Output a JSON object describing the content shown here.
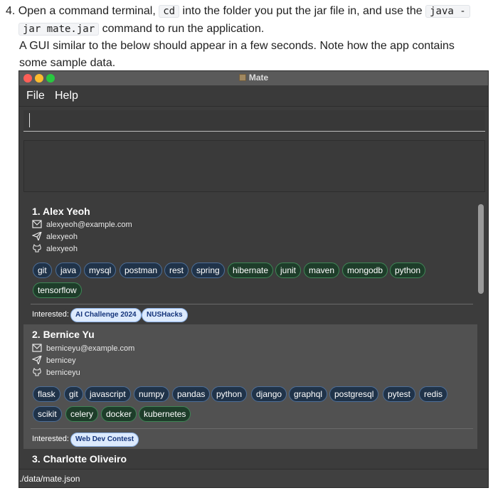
{
  "instructions": {
    "step_number": "4.",
    "line1_pre": "Open a command terminal,",
    "line1_code1": "cd",
    "line1_mid": "into the folder you put the jar file in, and use the",
    "line1_code2": "java -",
    "line2_code": "jar mate.jar",
    "line2_post": "command to run the application.",
    "line3": "A GUI similar to the below should appear in a few seconds. Note how the app contains",
    "line4": "some sample data."
  },
  "window": {
    "title": "Mate",
    "menu": [
      "File",
      "Help"
    ],
    "command_input_value": "",
    "result_display_text": "",
    "status_bar_path": "./data/mate.json"
  },
  "persons": [
    {
      "index_name": "1. Alex Yeoh",
      "email": "alexyeoh@example.com",
      "telegram": "alexyeoh",
      "github": "alexyeoh",
      "tags": [
        {
          "label": "git",
          "color": "blue"
        },
        {
          "label": "java",
          "color": "blue"
        },
        {
          "label": "mysql",
          "color": "blue"
        },
        {
          "label": "postman",
          "color": "blue"
        },
        {
          "label": "rest",
          "color": "blue"
        },
        {
          "label": "spring",
          "color": "blue"
        },
        {
          "label": "hibernate",
          "color": "green"
        },
        {
          "label": "junit",
          "color": "green"
        },
        {
          "label": "maven",
          "color": "green"
        },
        {
          "label": "mongodb",
          "color": "green"
        },
        {
          "label": "python",
          "color": "green"
        },
        {
          "label": "tensorflow",
          "color": "green"
        }
      ],
      "interested_label": "Interested:",
      "interested": [
        "AI Challenge 2024",
        "NUSHacks"
      ]
    },
    {
      "index_name": "2. Bernice Yu",
      "email": "berniceyu@example.com",
      "telegram": "bernicey",
      "github": "berniceyu",
      "tags": [
        {
          "label": "flask",
          "color": "blue"
        },
        {
          "label": "git",
          "color": "blue"
        },
        {
          "label": "javascript",
          "color": "blue"
        },
        {
          "label": "numpy",
          "color": "blue"
        },
        {
          "label": "pandas",
          "color": "blue"
        },
        {
          "label": "python",
          "color": "blue"
        },
        {
          "label": "django",
          "color": "blue"
        },
        {
          "label": "graphql",
          "color": "blue"
        },
        {
          "label": "postgresql",
          "color": "blue"
        },
        {
          "label": "pytest",
          "color": "blue"
        },
        {
          "label": "redis",
          "color": "blue"
        },
        {
          "label": "scikit",
          "color": "blue"
        },
        {
          "label": "celery",
          "color": "green"
        },
        {
          "label": "docker",
          "color": "green"
        },
        {
          "label": "kubernetes",
          "color": "green"
        }
      ],
      "interested_label": "Interested:",
      "interested": [
        "Web Dev Contest"
      ]
    },
    {
      "index_name": "3. Charlotte Oliveiro"
    }
  ],
  "colors": {
    "window_bg": "#3c3c3c",
    "tag_blue_bg": "#203349",
    "tag_green_bg": "#1e3d2a",
    "interest_pill_bg": "#dceafd"
  }
}
